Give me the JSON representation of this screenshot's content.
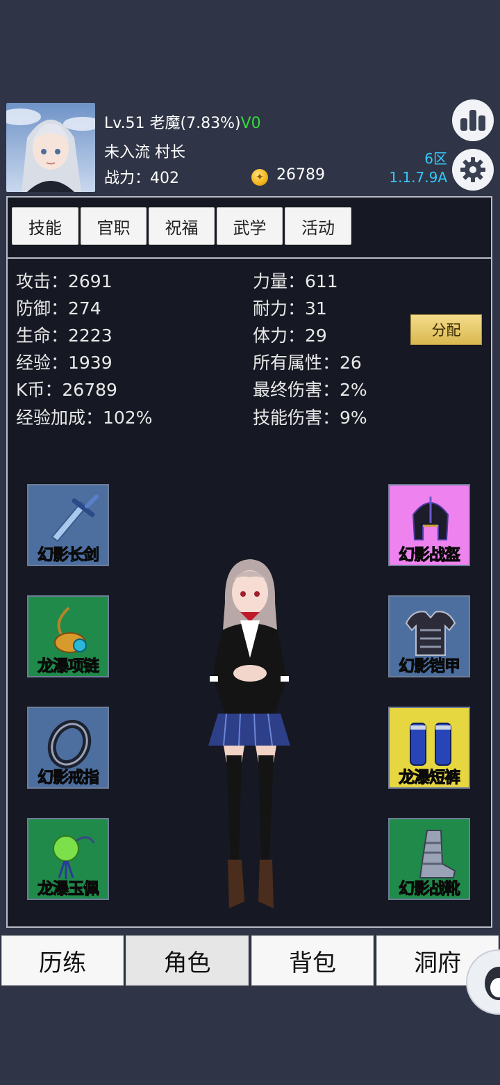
{
  "player": {
    "level_line_prefix": "Lv.51 老魔(7.83%)",
    "vip": "V0",
    "rank_line": "未入流 村长",
    "power_line": "战力：402",
    "coins": "26789",
    "server": "6区",
    "version": "1.1.7.9A"
  },
  "tabs": [
    "技能",
    "官职",
    "祝福",
    "武学",
    "活动"
  ],
  "stats_left": [
    "攻击：2691",
    "防御：274",
    "生命：2223",
    "经验：1939",
    "K币：26789",
    "经验加成：102%"
  ],
  "stats_right": [
    "力量：611",
    "耐力：31",
    "体力：29",
    "所有属性：26",
    "最终伤害：2%",
    "技能伤害：9%"
  ],
  "allocate_label": "分配",
  "equipment_left": [
    {
      "name": "幻影长剑",
      "icon": "sword-icon",
      "label_color": "#34d6ff",
      "bg": "#4d6fa0"
    },
    {
      "name": "龙瀑项链",
      "icon": "necklace-icon",
      "label_color": "#5dff6a",
      "bg": "#1f8a4a"
    },
    {
      "name": "幻影戒指",
      "icon": "ring-icon",
      "label_color": "#34d6ff",
      "bg": "#4d6fa0"
    },
    {
      "name": "龙瀑玉佩",
      "icon": "jade-pendant-icon",
      "label_color": "#5dff6a",
      "bg": "#1f8a4a"
    }
  ],
  "equipment_right": [
    {
      "name": "幻影战盔",
      "icon": "helmet-icon",
      "label_color": "#a020d0",
      "bg": "#ee82ee"
    },
    {
      "name": "幻影铠甲",
      "icon": "armor-icon",
      "label_color": "#34d6ff",
      "bg": "#4d6fa0"
    },
    {
      "name": "龙瀑短裤",
      "icon": "leg-guards-icon",
      "label_color": "#ffe84a",
      "bg": "#e6d640"
    },
    {
      "name": "幻影战靴",
      "icon": "boots-icon",
      "label_color": "#5dff6a",
      "bg": "#1f8a4a"
    }
  ],
  "nav": [
    "历练",
    "角色",
    "背包",
    "洞府"
  ],
  "active_nav": "角色"
}
